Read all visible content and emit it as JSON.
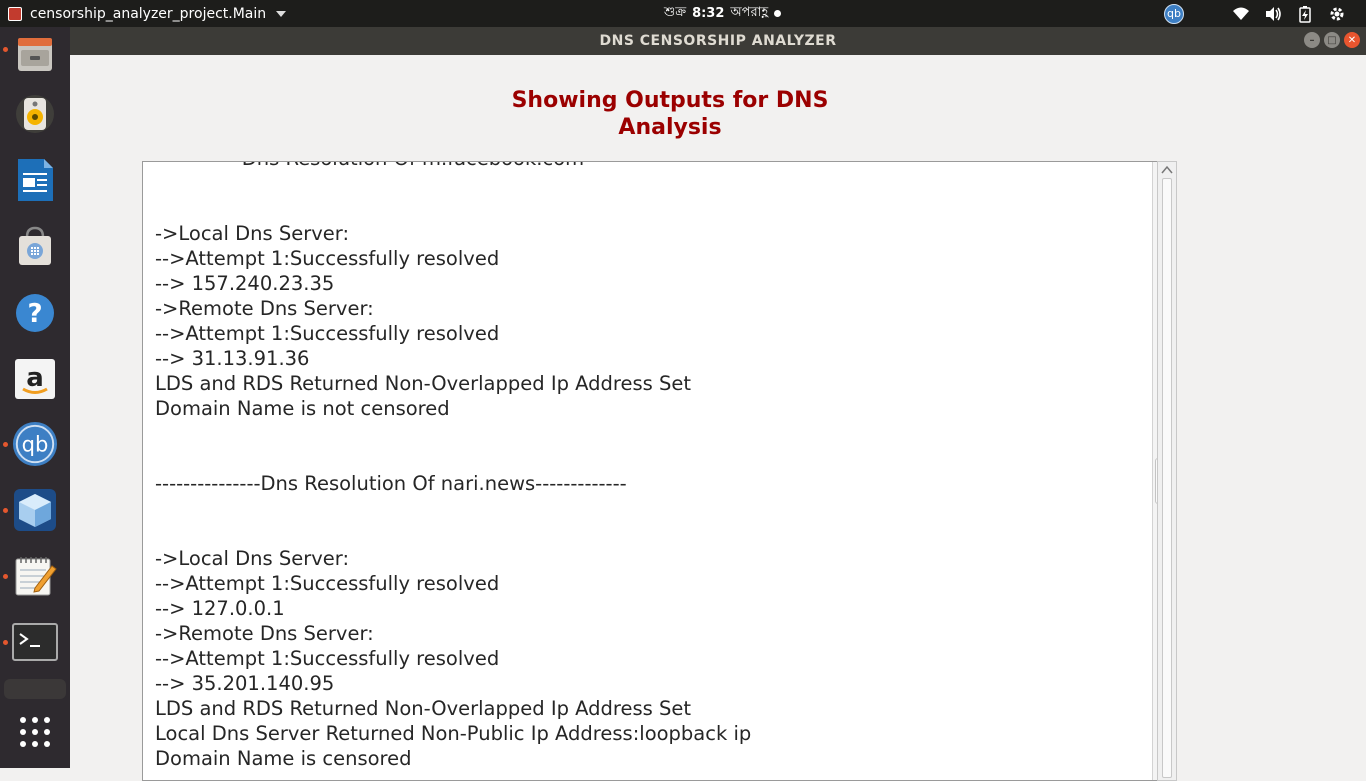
{
  "top_panel": {
    "app_name": "censorship_analyzer_project.Main",
    "clock_day": "শুক্র",
    "clock_time": "8:32",
    "clock_period": "অপরাহ্ণ",
    "tray_qb_label": "qb"
  },
  "launcher": {
    "items": [
      {
        "name": "files",
        "icon": "file-cabinet-icon",
        "running": true
      },
      {
        "name": "rhythmbox",
        "icon": "speaker-icon",
        "running": false
      },
      {
        "name": "libreoffice-writer",
        "icon": "document-icon",
        "running": false
      },
      {
        "name": "software-center",
        "icon": "shopping-bag-icon",
        "running": false
      },
      {
        "name": "help",
        "icon": "question-icon",
        "running": false
      },
      {
        "name": "amazon",
        "icon": "amazon-icon",
        "running": false
      },
      {
        "name": "qbittorrent",
        "icon": "qbittorrent-icon",
        "running": true,
        "label": "qb"
      },
      {
        "name": "virtualbox",
        "icon": "cube-icon",
        "running": true
      },
      {
        "name": "text-editor",
        "icon": "notepad-icon",
        "running": true
      },
      {
        "name": "terminal",
        "icon": "terminal-icon",
        "running": true
      },
      {
        "name": "app-grid",
        "icon": "grid-icon",
        "running": false
      }
    ]
  },
  "window": {
    "title": "DNS CENSORSHIP ANALYZER"
  },
  "main": {
    "heading_line1": "Showing Outputs for DNS",
    "heading_line2": "Analysis",
    "output_lines": [
      "              Dns Resolution Of m.facebook.com",
      "",
      "",
      "->Local Dns Server:",
      "-->Attempt 1:Successfully resolved",
      "--> 157.240.23.35",
      "->Remote Dns Server:",
      "-->Attempt 1:Successfully resolved",
      "--> 31.13.91.36",
      "LDS and RDS Returned Non-Overlapped Ip Address Set",
      "Domain Name is not censored",
      "",
      "",
      "---------------Dns Resolution Of nari.news-------------",
      "",
      "",
      "->Local Dns Server:",
      "-->Attempt 1:Successfully resolved",
      "--> 127.0.0.1",
      "->Remote Dns Server:",
      "-->Attempt 1:Successfully resolved",
      "--> 35.201.140.95",
      "LDS and RDS Returned Non-Overlapped Ip Address Set",
      "Local Dns Server Returned Non-Public Ip Address:loopback ip",
      "Domain Name is censored"
    ]
  },
  "colors": {
    "heading": "#9b0000",
    "titlebar": "#3c3b37",
    "launcher": "#2e2a2f",
    "panel": "#1d1d1b"
  }
}
